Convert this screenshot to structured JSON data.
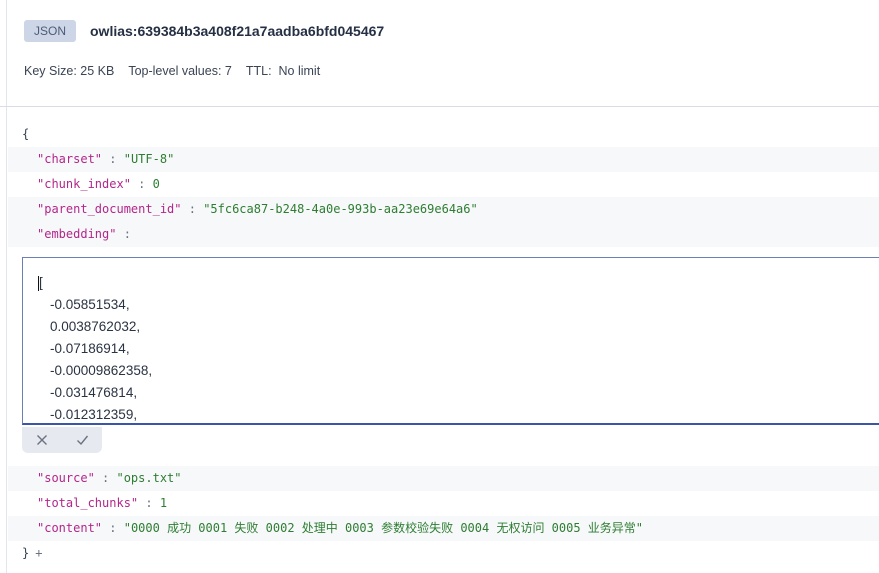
{
  "header": {
    "type_badge": "JSON",
    "key_name": "owlias:639384b3a408f21a7aadba6bfd045467",
    "key_size": "Key Size: 25 KB",
    "top_level_values": "Top-level values: 7",
    "ttl_label": "TTL:",
    "ttl_value": "No limit"
  },
  "json": {
    "open_brace": "{",
    "close_brace": "}",
    "top_rows": [
      {
        "key": "\"charset\"",
        "sep": " : ",
        "value": "\"UTF-8\""
      },
      {
        "key": "\"chunk_index\"",
        "sep": " : ",
        "value": "0"
      },
      {
        "key": "\"parent_document_id\"",
        "sep": " : ",
        "value": "\"5fc6ca87-b248-4a0e-993b-aa23e69e64a6\""
      },
      {
        "key": "\"embedding\"",
        "sep": " :",
        "value": ""
      }
    ],
    "bottom_rows": [
      {
        "key": "\"source\"",
        "sep": " : ",
        "value": "\"ops.txt\""
      },
      {
        "key": "\"total_chunks\"",
        "sep": " : ",
        "value": "1"
      },
      {
        "key": "\"content\"",
        "sep": " : ",
        "value": "\"0000 成功 0001 失败 0002 处理中 0003 参数校验失败 0004 无权访问 0005 业务异常\""
      }
    ],
    "add_label": "+"
  },
  "editor": {
    "open_bracket": "[",
    "values": [
      "-0.05851534,",
      "0.0038762032,",
      "-0.07186914,",
      "-0.00009862358,",
      "-0.031476814,",
      "-0.012312359,"
    ]
  },
  "icons": {
    "cancel": "close-icon",
    "confirm": "check-icon"
  }
}
